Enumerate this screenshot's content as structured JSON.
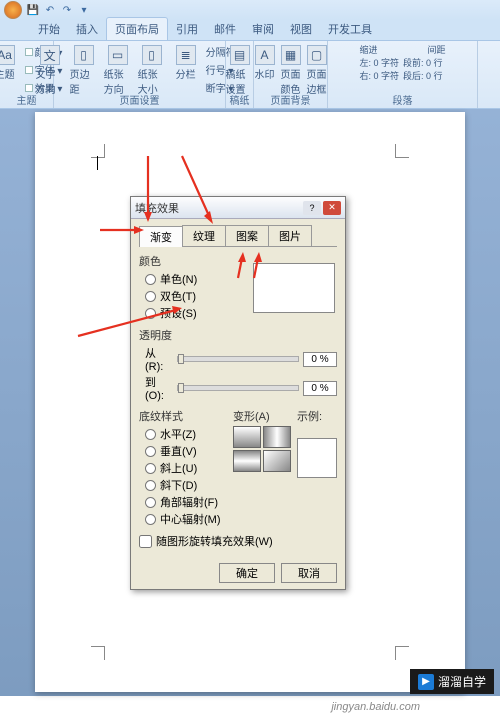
{
  "titlebar": {
    "qat": [
      "save",
      "undo",
      "redo",
      "dropdown"
    ]
  },
  "tabs": {
    "items": [
      "开始",
      "插入",
      "页面布局",
      "引用",
      "邮件",
      "审阅",
      "视图",
      "开发工具"
    ],
    "active_index": 2
  },
  "ribbon": {
    "groups": [
      {
        "label": "主题",
        "theme_btn": "主题",
        "side": [
          "颜色 ▾",
          "字体 ▾",
          "效果 ▾"
        ]
      },
      {
        "label": "页面设置",
        "buttons": [
          "文字方向",
          "页边距",
          "纸张方向",
          "纸张大小",
          "分栏"
        ],
        "side": [
          "分隔符 ▾",
          "行号 ▾",
          "断字 ▾"
        ]
      },
      {
        "label": "稿纸",
        "buttons": [
          "稿纸设置"
        ]
      },
      {
        "label": "页面背景",
        "buttons": [
          "水印",
          "页面颜色",
          "页面边框"
        ]
      },
      {
        "label": "段落",
        "indent_label": "缩进",
        "spacing_label": "间距",
        "indent_left": "左: 0 字符",
        "indent_right": "右: 0 字符",
        "spacing_before": "段前: 0 行",
        "spacing_after": "段后: 0 行"
      }
    ]
  },
  "dialog": {
    "title": "填充效果",
    "tabs": [
      "渐变",
      "纹理",
      "图案",
      "图片"
    ],
    "active_tab": 0,
    "color_section": {
      "label": "颜色",
      "options": [
        "单色(N)",
        "双色(T)",
        "预设(S)"
      ]
    },
    "transparency": {
      "label": "透明度",
      "from_label": "从(R):",
      "to_label": "到(O):",
      "from_val": "0 %",
      "to_val": "0 %"
    },
    "style_section": {
      "label": "底纹样式",
      "options": [
        "水平(Z)",
        "垂直(V)",
        "斜上(U)",
        "斜下(D)",
        "角部辐射(F)",
        "中心辐射(M)"
      ],
      "variant_label": "变形(A)",
      "sample_label": "示例:"
    },
    "rotate_check": "随图形旋转填充效果(W)",
    "ok": "确定",
    "cancel": "取消"
  },
  "watermark": {
    "text": "溜溜自学"
  },
  "bottom_url": "jingyan.baidu.com"
}
